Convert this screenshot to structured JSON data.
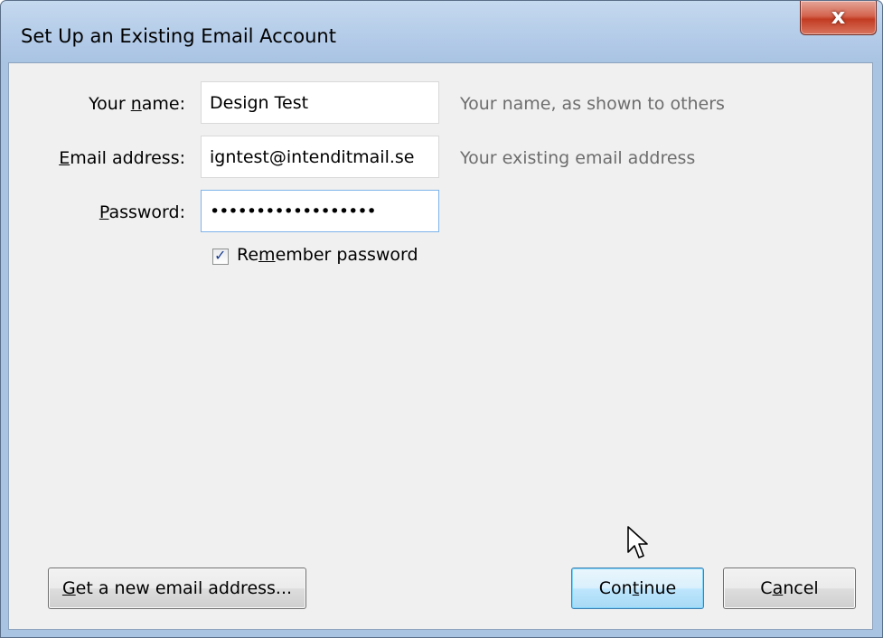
{
  "window": {
    "title": "Set Up an Existing Email Account",
    "close_glyph": "x"
  },
  "form": {
    "name": {
      "label_pre": "Your ",
      "label_accel": "n",
      "label_post": "ame:",
      "value": "Design Test",
      "hint": "Your name, as shown to others"
    },
    "email": {
      "label_pre": "",
      "label_accel": "E",
      "label_post": "mail address:",
      "value": "igntest@intenditmail.se",
      "hint": "Your existing email address"
    },
    "password": {
      "label_pre": "",
      "label_accel": "P",
      "label_post": "assword:",
      "value": "••••••••••••••••••"
    },
    "remember": {
      "label_pre": "Re",
      "label_accel": "m",
      "label_post": "ember password",
      "checked": true,
      "check_glyph": "✓"
    }
  },
  "buttons": {
    "new_email": {
      "label_pre": "",
      "label_accel": "G",
      "label_post": "et a new email address..."
    },
    "continue": {
      "label_pre": "Con",
      "label_accel": "t",
      "label_post": "inue"
    },
    "cancel": {
      "label_pre": "C",
      "label_accel": "a",
      "label_post": "ncel"
    }
  },
  "icons": {
    "close": "close-icon",
    "cursor": "mouse-pointer-icon",
    "check": "checkmark-icon"
  }
}
